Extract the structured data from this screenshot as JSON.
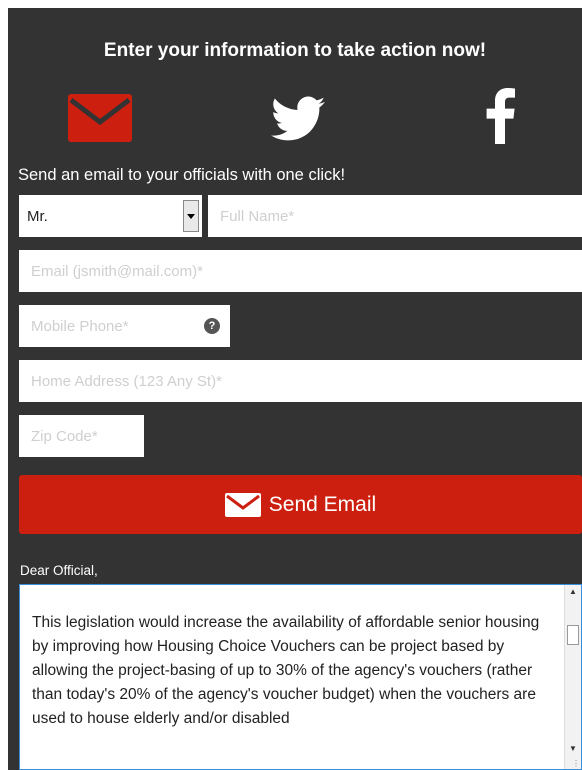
{
  "header": {
    "title": "Enter your information to take action now!"
  },
  "share_icons": [
    {
      "name": "email",
      "icon": "envelope-icon",
      "color": "#cc1f0f"
    },
    {
      "name": "twitter",
      "icon": "twitter-bird-icon",
      "color": "#ffffff"
    },
    {
      "name": "facebook",
      "icon": "facebook-f-icon",
      "color": "#ffffff"
    }
  ],
  "form": {
    "subtitle": "Send an email to your officials with one click!",
    "prefix": {
      "value": "Mr."
    },
    "full_name": {
      "placeholder": "Full Name*"
    },
    "email": {
      "placeholder": "Email (jsmith@mail.com)*"
    },
    "mobile_phone": {
      "placeholder": "Mobile Phone*",
      "help_icon": "?"
    },
    "home_address": {
      "placeholder": "Home Address (123 Any St)*"
    },
    "zip_code": {
      "placeholder": "Zip Code*"
    },
    "send_label": "Send Email"
  },
  "message": {
    "greeting": "Dear Official,",
    "body": "This legislation would increase the availability of affordable senior housing by improving how Housing Choice Vouchers can be project based by allowing the project-basing of up to 30% of the agency's vouchers (rather than today's 20% of the agency's voucher budget) when the vouchers are used to house elderly and/or disabled"
  },
  "colors": {
    "panel": "#333333",
    "accent": "#cc1f0f",
    "text": "#ffffff"
  }
}
